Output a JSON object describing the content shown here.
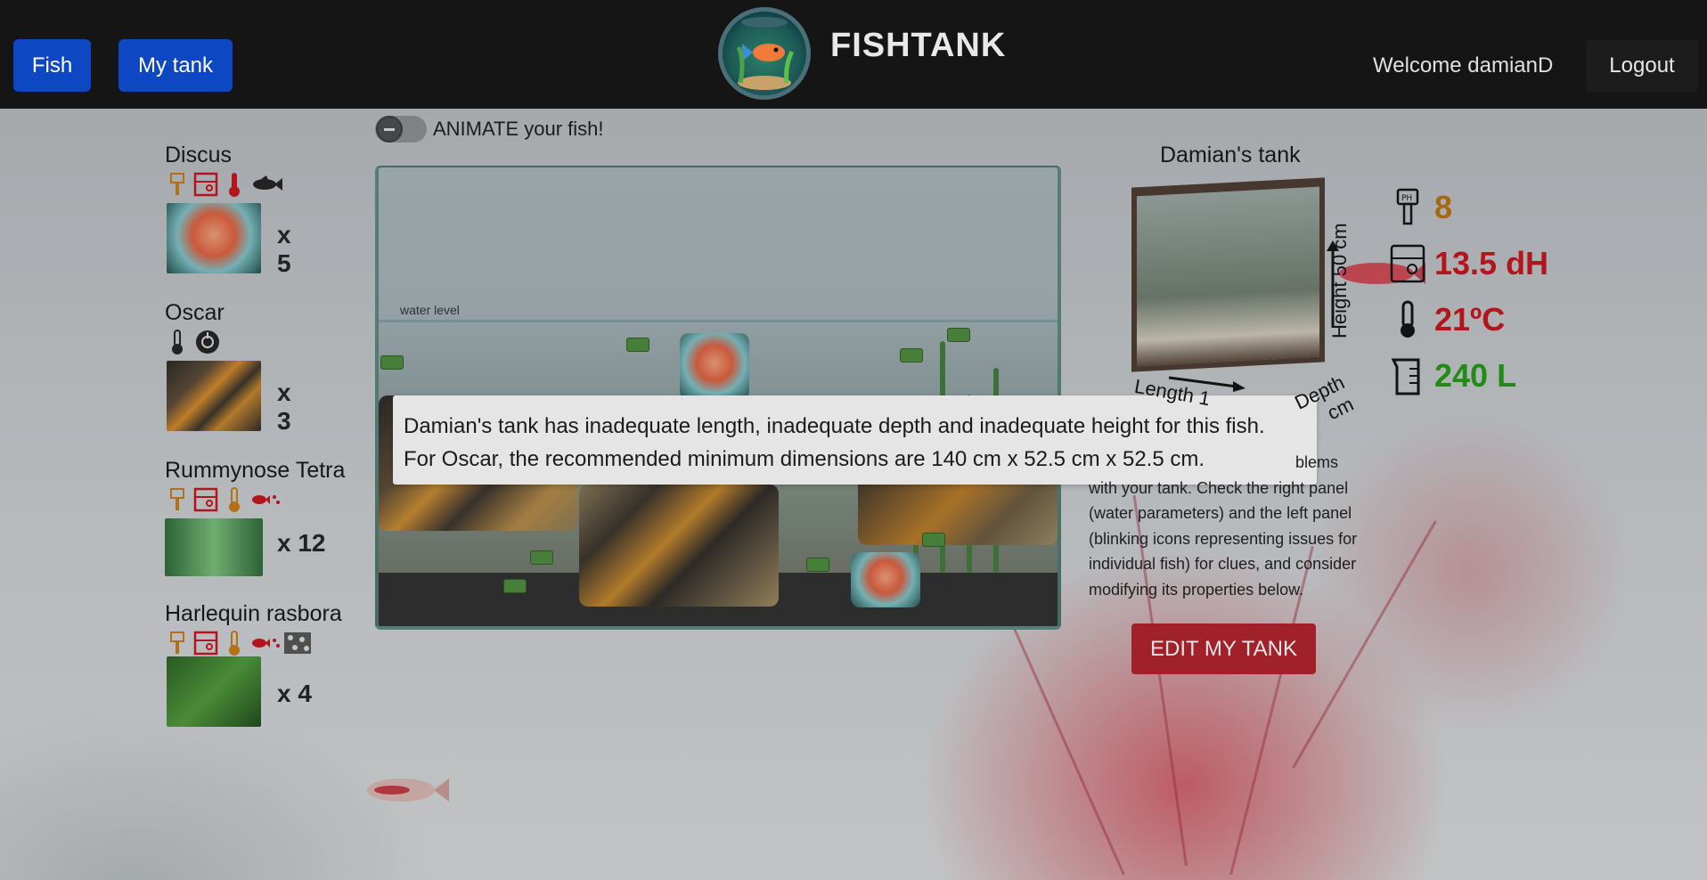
{
  "header": {
    "nav": [
      {
        "label": "Fish"
      },
      {
        "label": "My tank"
      }
    ],
    "brand": "FISHTANK",
    "welcome": "Welcome damianD",
    "logout": "Logout"
  },
  "toggle": {
    "label": "ANIMATE your fish!",
    "checked": false
  },
  "fish_list": [
    {
      "name": "Discus",
      "count": "x 5",
      "icons": [
        "ph-icon",
        "hardness-icon",
        "thermometer-icon",
        "fish-size-icon"
      ]
    },
    {
      "name": "Oscar",
      "count": "x 3",
      "icons": [
        "thermometer-icon",
        "aggression-icon"
      ]
    },
    {
      "name": "Rummynose Tetra",
      "count": "x 12",
      "icons": [
        "ph-icon",
        "hardness-icon",
        "thermometer-icon",
        "schooling-icon"
      ]
    },
    {
      "name": "Harlequin rasbora",
      "count": "x 4",
      "icons": [
        "ph-icon",
        "hardness-icon",
        "thermometer-icon",
        "schooling-icon",
        "pattern-icon"
      ]
    }
  ],
  "aquarium": {
    "water_level_label": "water level"
  },
  "tooltip": {
    "line1": "Damian's tank has inadequate length, inadequate depth and inadequate height for this fish.",
    "line2": "For Oscar, the recommended minimum dimensions are 140 cm x 52.5 cm x 52.5 cm."
  },
  "tank_panel": {
    "title": "Damian's tank",
    "height_label": "Height 50 cm",
    "length_label": "Length 1",
    "depth_label": "Depth",
    "depth_value": "cm",
    "params": [
      {
        "icon": "ph-icon",
        "value": "8",
        "color": "#b5720f"
      },
      {
        "icon": "hardness-icon",
        "value": "13.5 dH",
        "color": "#c8121b"
      },
      {
        "icon": "thermometer-icon",
        "value": "21ºC",
        "color": "#c8121b"
      },
      {
        "icon": "volume-icon",
        "value": "240 L",
        "color": "#1f9a12"
      }
    ],
    "help_text_line1": "blems",
    "help_text_line2": "with your tank. Check the right panel",
    "help_text_line3": "(water parameters) and the left panel",
    "help_text_line4": "(blinking icons representing issues for",
    "help_text_line5": "individual fish) for clues, and consider",
    "help_text_line6": "modifying its properties below.",
    "edit_button": "EDIT MY TANK"
  },
  "colors": {
    "header_bg": "#151515",
    "nav_button": "#0d47c4",
    "danger_icon": "#c8121b",
    "warning_icon": "#c77a12",
    "edit_button": "#b1202b"
  }
}
